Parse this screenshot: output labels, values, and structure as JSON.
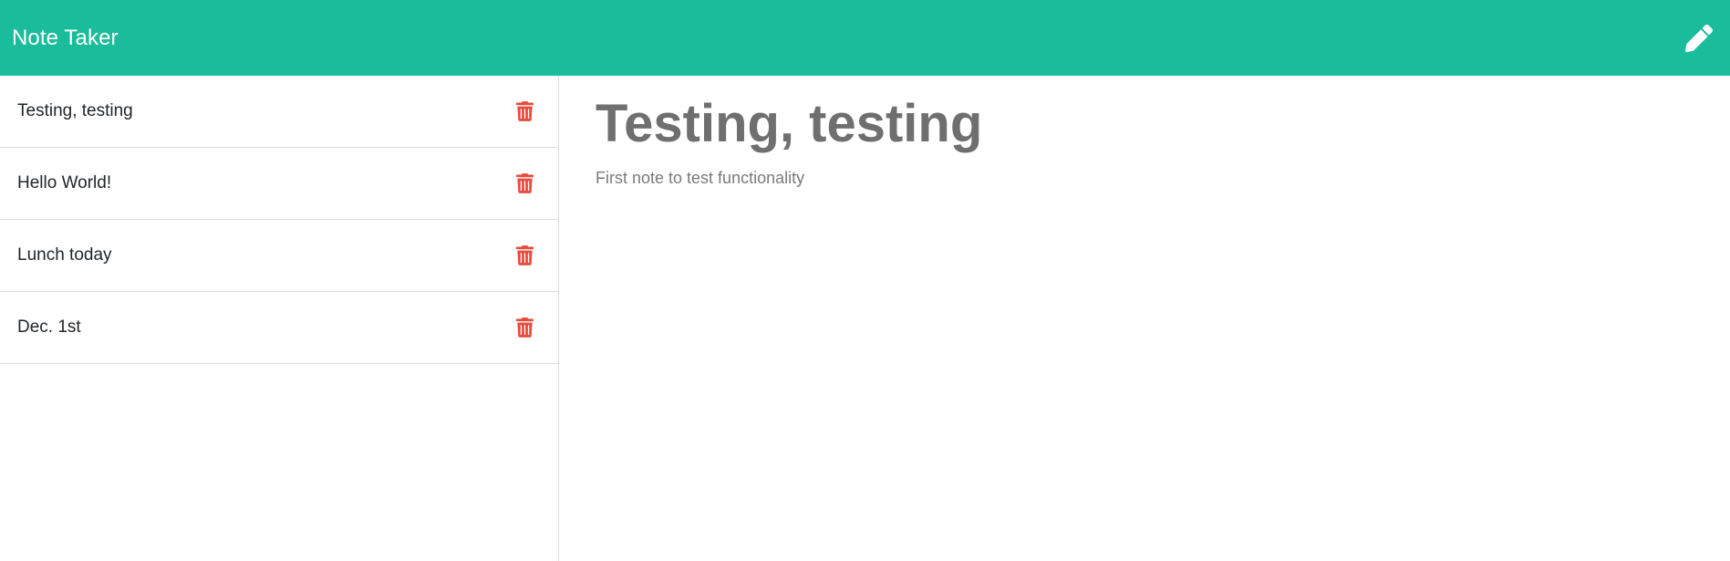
{
  "header": {
    "title": "Note Taker",
    "new_note_icon": "pencil-icon",
    "background_color": "#1abc9c"
  },
  "sidebar": {
    "notes": [
      {
        "title": "Testing, testing",
        "delete_icon": "trash-icon"
      },
      {
        "title": "Hello World!",
        "delete_icon": "trash-icon"
      },
      {
        "title": "Lunch today",
        "delete_icon": "trash-icon"
      },
      {
        "title": "Dec. 1st",
        "delete_icon": "trash-icon"
      }
    ],
    "delete_color": "#e74c3c"
  },
  "main": {
    "note_title": "Testing, testing",
    "note_text": "First note to test functionality"
  }
}
